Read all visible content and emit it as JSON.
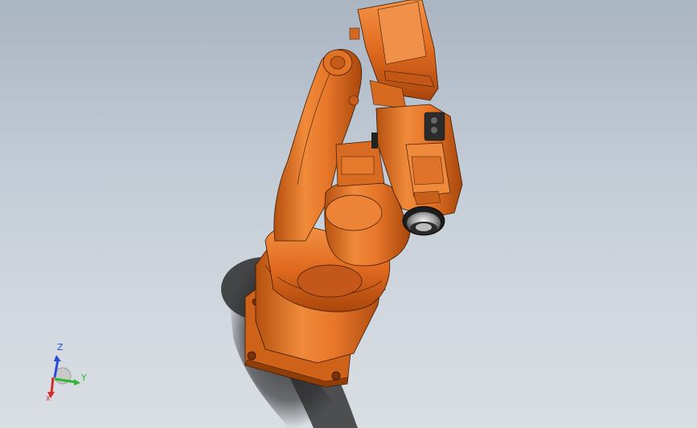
{
  "viewport": {
    "background_top": "#aab5c2",
    "background_bottom": "#d9dee3",
    "model": {
      "name": "robot-arm",
      "color": "#e8772a",
      "shadow_color": "#2f2f32"
    }
  },
  "triad": {
    "axes": [
      {
        "label": "Z",
        "color": "#2b49d9"
      },
      {
        "label": "Y",
        "color": "#2fb52f"
      },
      {
        "label": "X",
        "color": "#d62b2b"
      }
    ]
  }
}
